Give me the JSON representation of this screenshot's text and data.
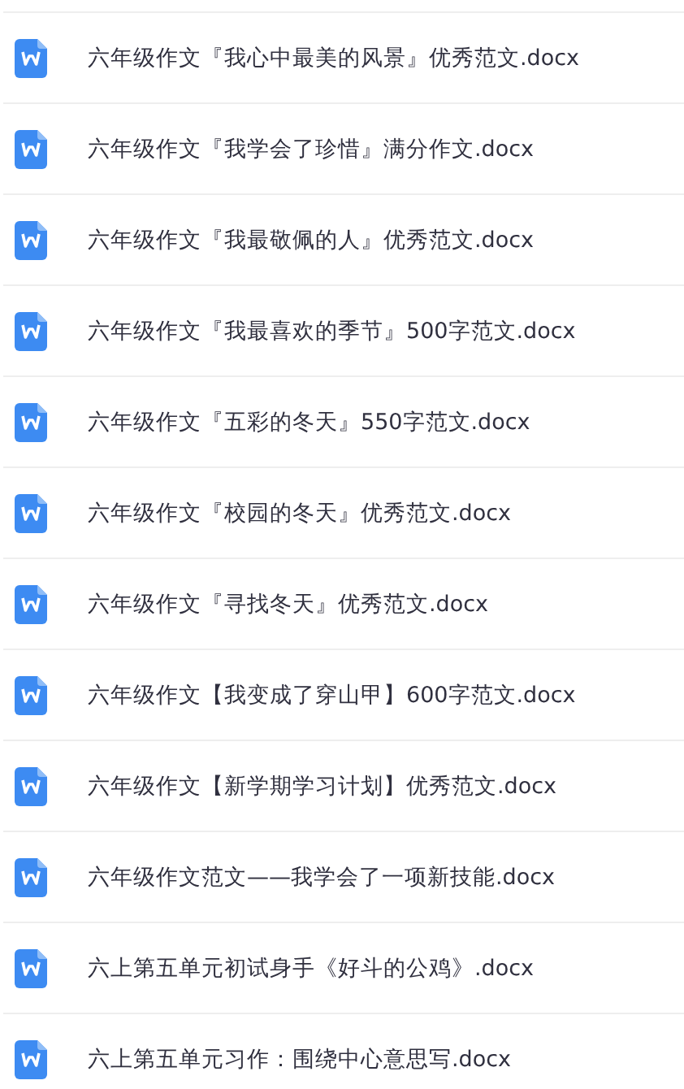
{
  "files": [
    {
      "name": "六年级作文『我心中最美的风景』优秀范文.docx"
    },
    {
      "name": "六年级作文『我学会了珍惜』满分作文.docx"
    },
    {
      "name": "六年级作文『我最敬佩的人』优秀范文.docx"
    },
    {
      "name": "六年级作文『我最喜欢的季节』500字范文.docx"
    },
    {
      "name": "六年级作文『五彩的冬天』550字范文.docx"
    },
    {
      "name": "六年级作文『校园的冬天』优秀范文.docx"
    },
    {
      "name": "六年级作文『寻找冬天』优秀范文.docx"
    },
    {
      "name": "六年级作文【我变成了穿山甲】600字范文.docx"
    },
    {
      "name": "六年级作文【新学期学习计划】优秀范文.docx"
    },
    {
      "name": "六年级作文范文——我学会了一项新技能.docx"
    },
    {
      "name": "六上第五单元初试身手《好斗的公鸡》.docx"
    },
    {
      "name": "六上第五单元习作：围绕中心意思写.docx"
    }
  ]
}
